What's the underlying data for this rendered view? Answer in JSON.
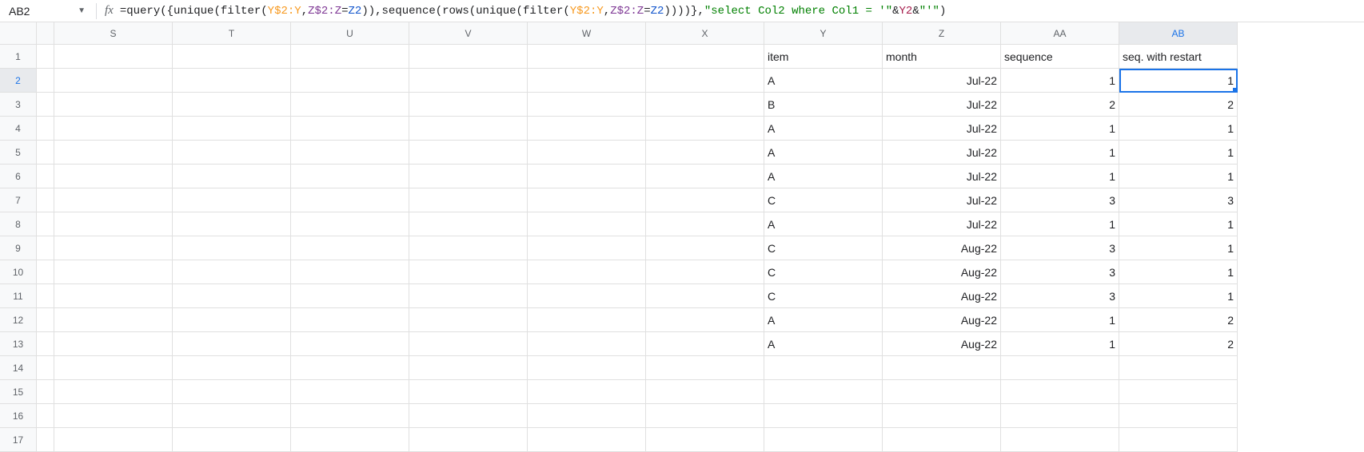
{
  "nameBox": {
    "value": "AB2"
  },
  "fxLabel": "fx",
  "formula": {
    "parts": [
      {
        "text": "=query({unique(filter(",
        "cls": "fn"
      },
      {
        "text": "Y$2:Y",
        "cls": "ref1"
      },
      {
        "text": ",",
        "cls": "fn"
      },
      {
        "text": "Z$2:Z",
        "cls": "ref2"
      },
      {
        "text": "=",
        "cls": "fn"
      },
      {
        "text": "Z2",
        "cls": "ref3"
      },
      {
        "text": ")),sequence(rows(unique(filter(",
        "cls": "fn"
      },
      {
        "text": "Y$2:Y",
        "cls": "ref1"
      },
      {
        "text": ",",
        "cls": "fn"
      },
      {
        "text": "Z$2:Z",
        "cls": "ref2"
      },
      {
        "text": "=",
        "cls": "fn"
      },
      {
        "text": "Z2",
        "cls": "ref3"
      },
      {
        "text": "))))},",
        "cls": "fn"
      },
      {
        "text": "\"select Col2 where Col1 = '\"",
        "cls": "str"
      },
      {
        "text": "&",
        "cls": "op"
      },
      {
        "text": "Y2",
        "cls": "ref4"
      },
      {
        "text": "&",
        "cls": "op"
      },
      {
        "text": "\"'\"",
        "cls": "str"
      },
      {
        "text": ")",
        "cls": "fn"
      }
    ]
  },
  "columns": [
    "S",
    "T",
    "U",
    "V",
    "W",
    "X",
    "Y",
    "Z",
    "AA",
    "AB"
  ],
  "selectedColumn": "AB",
  "rowNumbers": [
    "1",
    "2",
    "3",
    "4",
    "5",
    "6",
    "7",
    "8",
    "9",
    "10",
    "11",
    "12",
    "13",
    "14",
    "15",
    "16",
    "17"
  ],
  "selectedRow": "2",
  "headers": {
    "Y": "item",
    "Z": "month",
    "AA": "sequence",
    "AB": "seq. with restart"
  },
  "data": [
    {
      "Y": "A",
      "Z": "Jul-22",
      "AA": "1",
      "AB": "1"
    },
    {
      "Y": "B",
      "Z": "Jul-22",
      "AA": "2",
      "AB": "2"
    },
    {
      "Y": "A",
      "Z": "Jul-22",
      "AA": "1",
      "AB": "1"
    },
    {
      "Y": "A",
      "Z": "Jul-22",
      "AA": "1",
      "AB": "1"
    },
    {
      "Y": "A",
      "Z": "Jul-22",
      "AA": "1",
      "AB": "1"
    },
    {
      "Y": "C",
      "Z": "Jul-22",
      "AA": "3",
      "AB": "3"
    },
    {
      "Y": "A",
      "Z": "Jul-22",
      "AA": "1",
      "AB": "1"
    },
    {
      "Y": "C",
      "Z": "Aug-22",
      "AA": "3",
      "AB": "1"
    },
    {
      "Y": "C",
      "Z": "Aug-22",
      "AA": "3",
      "AB": "1"
    },
    {
      "Y": "C",
      "Z": "Aug-22",
      "AA": "3",
      "AB": "1"
    },
    {
      "Y": "A",
      "Z": "Aug-22",
      "AA": "1",
      "AB": "2"
    },
    {
      "Y": "A",
      "Z": "Aug-22",
      "AA": "1",
      "AB": "2"
    }
  ],
  "selectedCell": {
    "row": 2,
    "col": "AB"
  }
}
